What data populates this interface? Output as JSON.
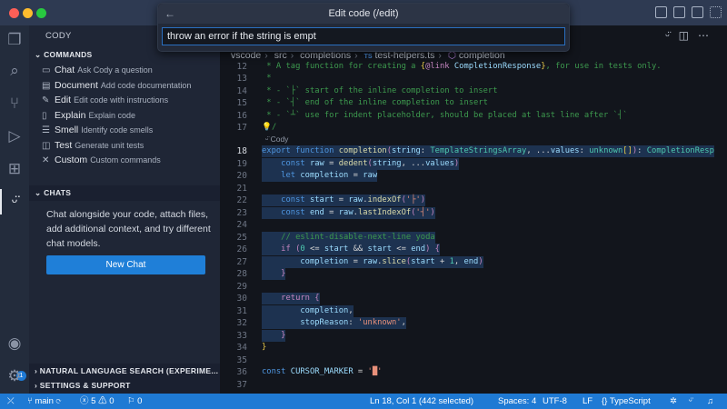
{
  "quick_input": {
    "title": "Edit code (/edit)",
    "value": "throw an error if the string is empt"
  },
  "sidebar": {
    "title": "CODY",
    "commands_header": "COMMANDS",
    "commands": [
      {
        "icon": "chat-icon",
        "glyph": "▭",
        "label": "Chat",
        "desc": "Ask Cody a question"
      },
      {
        "icon": "book-icon",
        "glyph": "▤",
        "label": "Document",
        "desc": "Add code documentation"
      },
      {
        "icon": "wand-icon",
        "glyph": "✎",
        "label": "Edit",
        "desc": "Edit code with instructions"
      },
      {
        "icon": "file-icon",
        "glyph": "▯",
        "label": "Explain",
        "desc": "Explain code"
      },
      {
        "icon": "list-icon",
        "glyph": "☰",
        "label": "Smell",
        "desc": "Identify code smells"
      },
      {
        "icon": "package-icon",
        "glyph": "◫",
        "label": "Test",
        "desc": "Generate unit tests"
      },
      {
        "icon": "tools-icon",
        "glyph": "✕",
        "label": "Custom",
        "desc": "Custom commands"
      }
    ],
    "chats_header": "CHATS",
    "chats_text": "Chat alongside your code, attach files, add additional context, and try different chat models.",
    "new_chat": "New Chat",
    "nl_search": "NATURAL LANGUAGE SEARCH (EXPERIME...",
    "settings": "SETTINGS & SUPPORT",
    "accounts_badge": "1"
  },
  "breadcrumb": [
    "vscode",
    "src",
    "completions",
    "test-helpers.ts",
    "completion"
  ],
  "codelens": "Cody",
  "code": [
    {
      "n": "12",
      "t": [
        [
          " * A tag function for creating a ",
          "cm"
        ],
        [
          "{",
          "yb"
        ],
        [
          "@link ",
          "pp"
        ],
        [
          "CompletionResponse",
          "va"
        ],
        [
          "}",
          "yb"
        ],
        [
          ", for use in tests only.",
          "cm"
        ]
      ]
    },
    {
      "n": "13",
      "t": [
        [
          " *",
          "cm"
        ]
      ]
    },
    {
      "n": "14",
      "t": [
        [
          " * - `├` start of the inline completion to insert",
          "cm"
        ]
      ]
    },
    {
      "n": "15",
      "t": [
        [
          " * - `┤` end of the inline completion to insert",
          "cm"
        ]
      ]
    },
    {
      "n": "16",
      "t": [
        [
          " * - `┴` use for indent placeholder, should be placed at last line after `┤`",
          "cm"
        ]
      ]
    },
    {
      "n": "17",
      "t": [
        [
          "💡/",
          "cm"
        ]
      ]
    },
    {
      "n": "18",
      "cur": true,
      "sel": true,
      "t": [
        [
          "export ",
          "kw"
        ],
        [
          "function ",
          "kw"
        ],
        [
          "completion",
          "fn"
        ],
        [
          "(",
          "pp"
        ],
        [
          "string",
          "va"
        ],
        [
          ": ",
          "pl"
        ],
        [
          "TemplateStringsArray",
          "ty"
        ],
        [
          ", ...",
          "pl"
        ],
        [
          "values",
          "va"
        ],
        [
          ": ",
          "pl"
        ],
        [
          "unknown",
          "ty"
        ],
        [
          "[]",
          "yb"
        ],
        [
          ")",
          "pp"
        ],
        [
          ": ",
          "pl"
        ],
        [
          "CompletionResp",
          "ty"
        ]
      ]
    },
    {
      "n": "19",
      "sel": true,
      "t": [
        [
          "    const ",
          "kw"
        ],
        [
          "raw",
          "va"
        ],
        [
          " = ",
          "pl"
        ],
        [
          "dedent",
          "fn"
        ],
        [
          "(",
          "pp"
        ],
        [
          "string",
          "va"
        ],
        [
          ", ...",
          "pl"
        ],
        [
          "values",
          "va"
        ],
        [
          ")",
          "pp"
        ]
      ]
    },
    {
      "n": "20",
      "sel": true,
      "t": [
        [
          "    let ",
          "kw"
        ],
        [
          "completion",
          "va"
        ],
        [
          " = ",
          "pl"
        ],
        [
          "raw",
          "va"
        ]
      ]
    },
    {
      "n": "21",
      "sel": true,
      "t": [
        [
          "",
          ""
        ]
      ]
    },
    {
      "n": "22",
      "sel": true,
      "t": [
        [
          "    const ",
          "kw"
        ],
        [
          "start",
          "va"
        ],
        [
          " = ",
          "pl"
        ],
        [
          "raw",
          "va"
        ],
        [
          ".",
          "pl"
        ],
        [
          "indexOf",
          "fn"
        ],
        [
          "(",
          "pp"
        ],
        [
          "'├'",
          "st"
        ],
        [
          ")",
          "pp"
        ]
      ]
    },
    {
      "n": "23",
      "sel": true,
      "t": [
        [
          "    const ",
          "kw"
        ],
        [
          "end",
          "va"
        ],
        [
          " = ",
          "pl"
        ],
        [
          "raw",
          "va"
        ],
        [
          ".",
          "pl"
        ],
        [
          "lastIndexOf",
          "fn"
        ],
        [
          "(",
          "pp"
        ],
        [
          "'┤'",
          "st"
        ],
        [
          ")",
          "pp"
        ]
      ]
    },
    {
      "n": "24",
      "sel": true,
      "t": [
        [
          "",
          ""
        ]
      ]
    },
    {
      "n": "25",
      "sel": true,
      "t": [
        [
          "    // eslint-disable-next-line yoda",
          "cm"
        ]
      ]
    },
    {
      "n": "26",
      "sel": true,
      "t": [
        [
          "    if ",
          "pp"
        ],
        [
          "(",
          "pp"
        ],
        [
          "0",
          "ty"
        ],
        [
          " <= ",
          "pl"
        ],
        [
          "start",
          "va"
        ],
        [
          " && ",
          "pl"
        ],
        [
          "start",
          "va"
        ],
        [
          " <= ",
          "pl"
        ],
        [
          "end",
          "va"
        ],
        [
          ") {",
          "pp"
        ]
      ]
    },
    {
      "n": "27",
      "sel": true,
      "t": [
        [
          "        completion",
          "va"
        ],
        [
          " = ",
          "pl"
        ],
        [
          "raw",
          "va"
        ],
        [
          ".",
          "pl"
        ],
        [
          "slice",
          "fn"
        ],
        [
          "(",
          "pp"
        ],
        [
          "start",
          "va"
        ],
        [
          " + ",
          "pl"
        ],
        [
          "1",
          "ty"
        ],
        [
          ", ",
          "pl"
        ],
        [
          "end",
          "va"
        ],
        [
          ")",
          "pp"
        ]
      ]
    },
    {
      "n": "28",
      "sel": true,
      "t": [
        [
          "    }",
          "pp"
        ]
      ]
    },
    {
      "n": "29",
      "sel": true,
      "t": [
        [
          "",
          ""
        ]
      ]
    },
    {
      "n": "30",
      "sel": true,
      "t": [
        [
          "    return ",
          "pp"
        ],
        [
          "{",
          "pp"
        ]
      ]
    },
    {
      "n": "31",
      "sel": true,
      "t": [
        [
          "        completion",
          "va"
        ],
        [
          ",",
          "pl"
        ]
      ]
    },
    {
      "n": "32",
      "sel": true,
      "t": [
        [
          "        stopReason",
          "va"
        ],
        [
          ": ",
          "pl"
        ],
        [
          "'unknown'",
          "st"
        ],
        [
          ",",
          "pl"
        ]
      ]
    },
    {
      "n": "33",
      "sel": true,
      "t": [
        [
          "    }",
          "pp"
        ]
      ]
    },
    {
      "n": "34",
      "t": [
        [
          "}",
          "yb"
        ]
      ]
    },
    {
      "n": "35",
      "t": [
        [
          "",
          ""
        ]
      ]
    },
    {
      "n": "36",
      "t": [
        [
          "const ",
          "kw"
        ],
        [
          "CURSOR_MARKER",
          "va"
        ],
        [
          " = ",
          "pl"
        ],
        [
          "'█'",
          "st"
        ]
      ]
    },
    {
      "n": "37",
      "t": [
        [
          "",
          ""
        ]
      ]
    }
  ],
  "status": {
    "branch": "main",
    "errors": "5",
    "warnings": "0",
    "ports": "0",
    "position": "Ln 18, Col 1 (442 selected)",
    "spaces": "Spaces: 4",
    "encoding": "UTF-8",
    "eol": "LF",
    "language": "TypeScript"
  }
}
